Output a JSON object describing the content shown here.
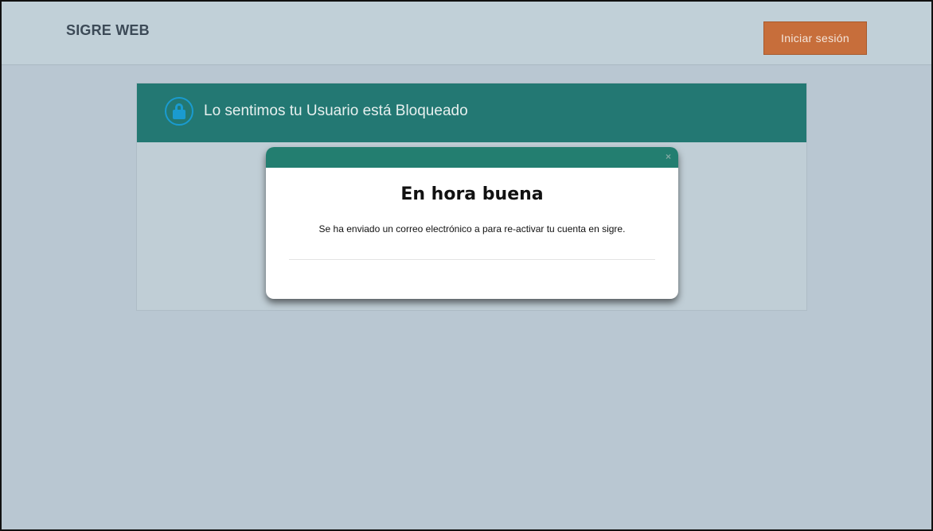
{
  "navbar": {
    "brand": "SIGRE WEB",
    "login_label": "Iniciar sesión"
  },
  "panel": {
    "icon": "lock-icon",
    "title": "Lo sentimos tu Usuario está Bloqueado"
  },
  "modal": {
    "close_label": "×",
    "title": "En hora buena",
    "message": "Se ha enviado un correo electrónico a para re-activar tu cuenta en sigre."
  },
  "colors": {
    "page_background": "#b9c7d2",
    "navbar_background": "#c1d0d8",
    "accent_teal": "#237873",
    "login_button": "#c76e3b",
    "lock_icon": "#1a9bd0"
  }
}
